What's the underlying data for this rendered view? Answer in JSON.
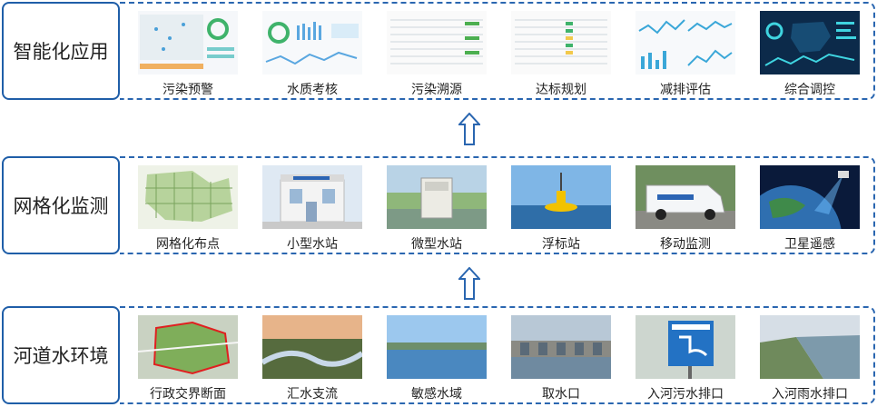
{
  "layers": [
    {
      "title": "智能化应用",
      "items": [
        "污染预警",
        "水质考核",
        "污染溯源",
        "达标规划",
        "减排评估",
        "综合调控"
      ]
    },
    {
      "title": "网格化监测",
      "items": [
        "网格化布点",
        "小型水站",
        "微型水站",
        "浮标站",
        "移动监测",
        "卫星遥感"
      ]
    },
    {
      "title": "河道水环境",
      "items": [
        "行政交界断面",
        "汇水支流",
        "敏感水域",
        "取水口",
        "入河污水排口",
        "入河雨水排口"
      ]
    }
  ],
  "colors": {
    "border": "#1f5ea8",
    "arrow": "#2a66b0"
  }
}
